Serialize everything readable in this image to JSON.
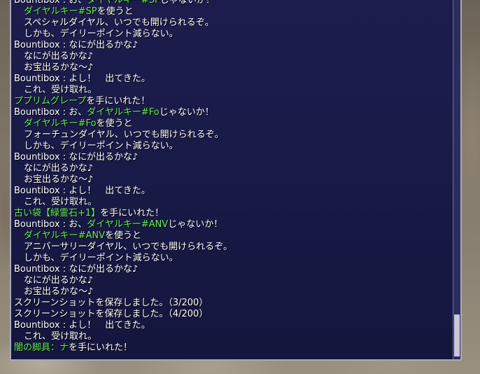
{
  "chat": {
    "lines": [
      {
        "indent": false,
        "parts": [
          {
            "t": "Bountibox : お、"
          },
          {
            "t": "ダイヤルキー#SP",
            "hl": true
          },
          {
            "t": "じゃないか！"
          }
        ]
      },
      {
        "indent": true,
        "parts": [
          {
            "t": "ダイヤルキー#SP",
            "hl": true
          },
          {
            "t": "を使うと"
          }
        ]
      },
      {
        "indent": true,
        "parts": [
          {
            "t": "スペシャルダイヤル、いつでも開けられるぞ。"
          }
        ]
      },
      {
        "indent": true,
        "parts": [
          {
            "t": "しかも、デイリーポイント減らない。"
          }
        ]
      },
      {
        "indent": false,
        "parts": [
          {
            "t": "Bountibox : なにが出るかな♪"
          }
        ]
      },
      {
        "indent": true,
        "parts": [
          {
            "t": "なにが出るかな♪"
          }
        ]
      },
      {
        "indent": true,
        "parts": [
          {
            "t": "お宝出るかな～♪"
          }
        ]
      },
      {
        "indent": false,
        "parts": [
          {
            "t": "Bountibox : よし！　出てきた。"
          }
        ]
      },
      {
        "indent": true,
        "parts": [
          {
            "t": "これ、受け取れ。"
          }
        ]
      },
      {
        "indent": false,
        "parts": [
          {
            "t": "ププリムグレープ",
            "hl": true
          },
          {
            "t": "を手にいれた！"
          }
        ]
      },
      {
        "indent": false,
        "parts": [
          {
            "t": "Bountibox : お、"
          },
          {
            "t": "ダイヤルキー#Fo",
            "hl": true
          },
          {
            "t": "じゃないか！"
          }
        ]
      },
      {
        "indent": true,
        "parts": [
          {
            "t": "ダイヤルキー#Fo",
            "hl": true
          },
          {
            "t": "を使うと"
          }
        ]
      },
      {
        "indent": true,
        "parts": [
          {
            "t": "フォーチュンダイヤル、いつでも開けられるぞ。"
          }
        ]
      },
      {
        "indent": true,
        "parts": [
          {
            "t": "しかも、デイリーポイント減らない。"
          }
        ]
      },
      {
        "indent": false,
        "parts": [
          {
            "t": "Bountibox : なにが出るかな♪"
          }
        ]
      },
      {
        "indent": true,
        "parts": [
          {
            "t": "なにが出るかな♪"
          }
        ]
      },
      {
        "indent": true,
        "parts": [
          {
            "t": "お宝出るかな～♪"
          }
        ]
      },
      {
        "indent": false,
        "parts": [
          {
            "t": "Bountibox : よし！　出てきた。"
          }
        ]
      },
      {
        "indent": true,
        "parts": [
          {
            "t": "これ、受け取れ。"
          }
        ]
      },
      {
        "indent": false,
        "parts": [
          {
            "t": "古い袋【緑霊石+1】",
            "hl": true
          },
          {
            "t": "を手にいれた！"
          }
        ]
      },
      {
        "indent": false,
        "parts": [
          {
            "t": "Bountibox : お、"
          },
          {
            "t": "ダイヤルキー#ANV",
            "hl": true
          },
          {
            "t": "じゃないか！"
          }
        ]
      },
      {
        "indent": true,
        "parts": [
          {
            "t": "ダイヤルキー#ANV",
            "hl": true
          },
          {
            "t": "を使うと"
          }
        ]
      },
      {
        "indent": true,
        "parts": [
          {
            "t": "アニバーサリーダイヤル、いつでも開けられるぞ。"
          }
        ]
      },
      {
        "indent": true,
        "parts": [
          {
            "t": "しかも、デイリーポイント減らない。"
          }
        ]
      },
      {
        "indent": false,
        "parts": [
          {
            "t": "Bountibox : なにが出るかな♪"
          }
        ]
      },
      {
        "indent": true,
        "parts": [
          {
            "t": "なにが出るかな♪"
          }
        ]
      },
      {
        "indent": true,
        "parts": [
          {
            "t": "お宝出るかな～♪"
          }
        ]
      },
      {
        "indent": false,
        "parts": [
          {
            "t": "スクリーンショットを保存しました。（3/200）"
          }
        ]
      },
      {
        "indent": false,
        "parts": [
          {
            "t": "スクリーンショットを保存しました。（4/200）"
          }
        ]
      },
      {
        "indent": false,
        "parts": [
          {
            "t": "Bountibox : よし！　出てきた。"
          }
        ]
      },
      {
        "indent": true,
        "parts": [
          {
            "t": "これ、受け取れ。"
          }
        ]
      },
      {
        "indent": false,
        "parts": [
          {
            "t": "闇の脚具：ナ",
            "hl": true
          },
          {
            "t": "を手にいれた！"
          }
        ]
      }
    ]
  },
  "colors": {
    "highlight": "#66ee55",
    "text": "#ffffff",
    "window": "#1c1d4d"
  }
}
